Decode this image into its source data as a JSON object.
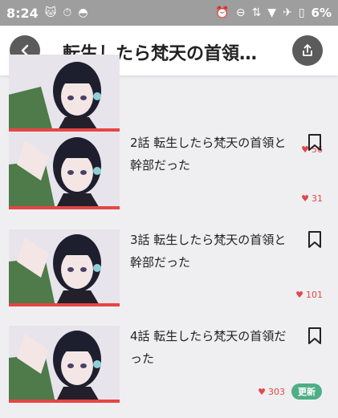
{
  "status_bar": {
    "time": "8:24",
    "battery": "6%",
    "left_icons": [
      "cat-icon",
      "timer-icon",
      "pokeball-icon"
    ],
    "right_icons": [
      "alarm-icon",
      "dnd-icon",
      "data-icon",
      "wifi-icon",
      "airplane-icon",
      "battery-icon"
    ]
  },
  "header": {
    "title": "転生したら梵天の首領…",
    "back_icon": "chevron-left-icon",
    "share_icon": "share-icon"
  },
  "episodes": [
    {
      "title": "",
      "likes": "56"
    },
    {
      "title": "2話 転生したら梵天の首領と幹部だった",
      "likes": "31"
    },
    {
      "title": "3話 転生したら梵天の首領と幹部だった",
      "likes": "101"
    },
    {
      "title": "4話 転生したら梵天の首領だった",
      "likes": "303",
      "badge": "更新"
    }
  ],
  "colors": {
    "accent_red": "#e64545",
    "badge_green": "#4fae86",
    "status_bar_gray": "#9e9e9e",
    "circle_button": "#5b5b5b"
  }
}
